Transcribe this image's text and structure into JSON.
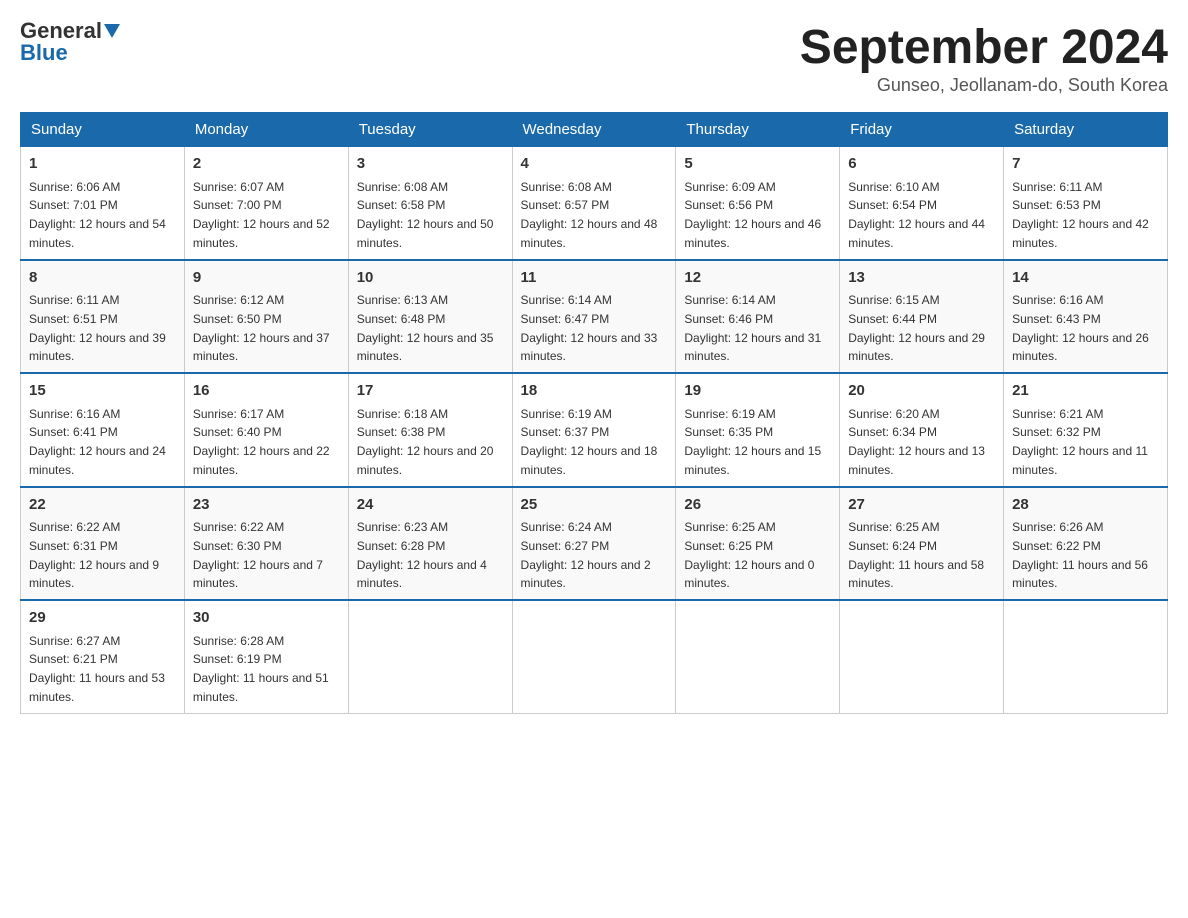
{
  "header": {
    "logo_general": "General",
    "logo_blue": "Blue",
    "month_title": "September 2024",
    "location": "Gunseo, Jeollanam-do, South Korea"
  },
  "days_of_week": [
    "Sunday",
    "Monday",
    "Tuesday",
    "Wednesday",
    "Thursday",
    "Friday",
    "Saturday"
  ],
  "weeks": [
    [
      {
        "day": "1",
        "sunrise": "6:06 AM",
        "sunset": "7:01 PM",
        "daylight": "12 hours and 54 minutes."
      },
      {
        "day": "2",
        "sunrise": "6:07 AM",
        "sunset": "7:00 PM",
        "daylight": "12 hours and 52 minutes."
      },
      {
        "day": "3",
        "sunrise": "6:08 AM",
        "sunset": "6:58 PM",
        "daylight": "12 hours and 50 minutes."
      },
      {
        "day": "4",
        "sunrise": "6:08 AM",
        "sunset": "6:57 PM",
        "daylight": "12 hours and 48 minutes."
      },
      {
        "day": "5",
        "sunrise": "6:09 AM",
        "sunset": "6:56 PM",
        "daylight": "12 hours and 46 minutes."
      },
      {
        "day": "6",
        "sunrise": "6:10 AM",
        "sunset": "6:54 PM",
        "daylight": "12 hours and 44 minutes."
      },
      {
        "day": "7",
        "sunrise": "6:11 AM",
        "sunset": "6:53 PM",
        "daylight": "12 hours and 42 minutes."
      }
    ],
    [
      {
        "day": "8",
        "sunrise": "6:11 AM",
        "sunset": "6:51 PM",
        "daylight": "12 hours and 39 minutes."
      },
      {
        "day": "9",
        "sunrise": "6:12 AM",
        "sunset": "6:50 PM",
        "daylight": "12 hours and 37 minutes."
      },
      {
        "day": "10",
        "sunrise": "6:13 AM",
        "sunset": "6:48 PM",
        "daylight": "12 hours and 35 minutes."
      },
      {
        "day": "11",
        "sunrise": "6:14 AM",
        "sunset": "6:47 PM",
        "daylight": "12 hours and 33 minutes."
      },
      {
        "day": "12",
        "sunrise": "6:14 AM",
        "sunset": "6:46 PM",
        "daylight": "12 hours and 31 minutes."
      },
      {
        "day": "13",
        "sunrise": "6:15 AM",
        "sunset": "6:44 PM",
        "daylight": "12 hours and 29 minutes."
      },
      {
        "day": "14",
        "sunrise": "6:16 AM",
        "sunset": "6:43 PM",
        "daylight": "12 hours and 26 minutes."
      }
    ],
    [
      {
        "day": "15",
        "sunrise": "6:16 AM",
        "sunset": "6:41 PM",
        "daylight": "12 hours and 24 minutes."
      },
      {
        "day": "16",
        "sunrise": "6:17 AM",
        "sunset": "6:40 PM",
        "daylight": "12 hours and 22 minutes."
      },
      {
        "day": "17",
        "sunrise": "6:18 AM",
        "sunset": "6:38 PM",
        "daylight": "12 hours and 20 minutes."
      },
      {
        "day": "18",
        "sunrise": "6:19 AM",
        "sunset": "6:37 PM",
        "daylight": "12 hours and 18 minutes."
      },
      {
        "day": "19",
        "sunrise": "6:19 AM",
        "sunset": "6:35 PM",
        "daylight": "12 hours and 15 minutes."
      },
      {
        "day": "20",
        "sunrise": "6:20 AM",
        "sunset": "6:34 PM",
        "daylight": "12 hours and 13 minutes."
      },
      {
        "day": "21",
        "sunrise": "6:21 AM",
        "sunset": "6:32 PM",
        "daylight": "12 hours and 11 minutes."
      }
    ],
    [
      {
        "day": "22",
        "sunrise": "6:22 AM",
        "sunset": "6:31 PM",
        "daylight": "12 hours and 9 minutes."
      },
      {
        "day": "23",
        "sunrise": "6:22 AM",
        "sunset": "6:30 PM",
        "daylight": "12 hours and 7 minutes."
      },
      {
        "day": "24",
        "sunrise": "6:23 AM",
        "sunset": "6:28 PM",
        "daylight": "12 hours and 4 minutes."
      },
      {
        "day": "25",
        "sunrise": "6:24 AM",
        "sunset": "6:27 PM",
        "daylight": "12 hours and 2 minutes."
      },
      {
        "day": "26",
        "sunrise": "6:25 AM",
        "sunset": "6:25 PM",
        "daylight": "12 hours and 0 minutes."
      },
      {
        "day": "27",
        "sunrise": "6:25 AM",
        "sunset": "6:24 PM",
        "daylight": "11 hours and 58 minutes."
      },
      {
        "day": "28",
        "sunrise": "6:26 AM",
        "sunset": "6:22 PM",
        "daylight": "11 hours and 56 minutes."
      }
    ],
    [
      {
        "day": "29",
        "sunrise": "6:27 AM",
        "sunset": "6:21 PM",
        "daylight": "11 hours and 53 minutes."
      },
      {
        "day": "30",
        "sunrise": "6:28 AM",
        "sunset": "6:19 PM",
        "daylight": "11 hours and 51 minutes."
      },
      null,
      null,
      null,
      null,
      null
    ]
  ]
}
